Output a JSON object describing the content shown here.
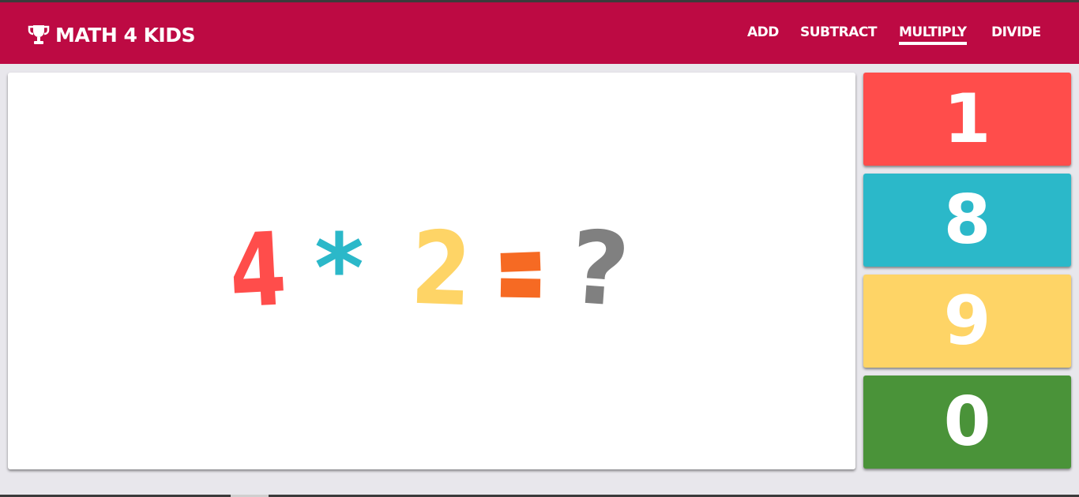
{
  "brand": {
    "title": "MATH 4 KIDS",
    "icon": "trophy-icon"
  },
  "nav": {
    "items": [
      {
        "label": "ADD",
        "active": false
      },
      {
        "label": "SUBTRACT",
        "active": false
      },
      {
        "label": "MULTIPLY",
        "active": true
      },
      {
        "label": "DIVIDE",
        "active": false
      }
    ]
  },
  "question": {
    "operand_a": "4",
    "operator": "*",
    "operand_b": "2",
    "equals": "=",
    "unknown": "?"
  },
  "answers": [
    {
      "value": "1",
      "color": "#ff4d4b"
    },
    {
      "value": "8",
      "color": "#2bb8c9"
    },
    {
      "value": "9",
      "color": "#fed466"
    },
    {
      "value": "0",
      "color": "#4a9339"
    }
  ],
  "colors": {
    "navbar": "#bd0a43",
    "background": "#e8e7ec",
    "card": "#ffffff",
    "operand_a": "#ff4d4b",
    "operator": "#2bb8c9",
    "operand_b": "#fed466",
    "equals": "#f66a23",
    "unknown": "#808080"
  }
}
